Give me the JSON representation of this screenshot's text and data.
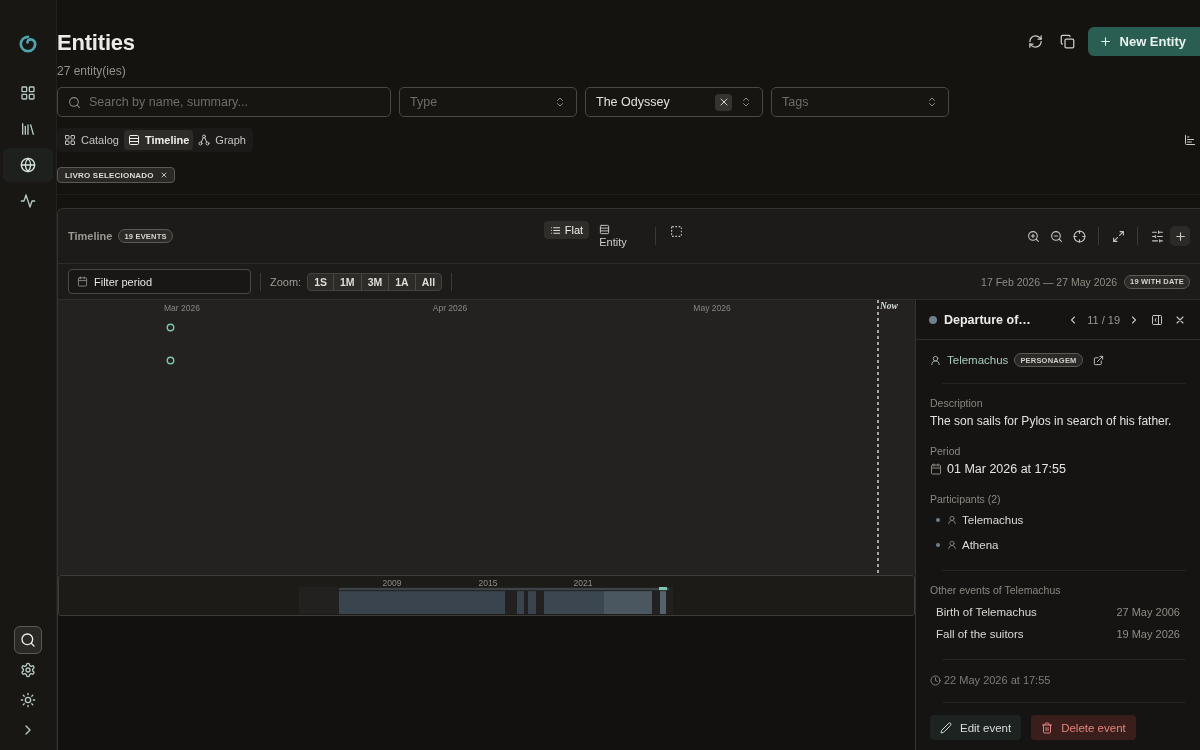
{
  "sidebar": {
    "nav": [
      {
        "kind": "grid",
        "selected": false
      },
      {
        "kind": "library",
        "selected": false
      },
      {
        "kind": "globe",
        "selected": true
      },
      {
        "kind": "pulse",
        "selected": false
      }
    ],
    "tools": [
      {
        "kind": "search",
        "selected": true
      },
      {
        "kind": "gear",
        "selected": false
      },
      {
        "kind": "sun",
        "selected": false
      },
      {
        "kind": "chevron",
        "selected": false
      }
    ]
  },
  "header": {
    "title": "Entities",
    "subtitle": "27 entity(ies)",
    "primary_button": "New Entity"
  },
  "filters": {
    "search": {
      "placeholder": "Search by name, summary..."
    },
    "type": {
      "placeholder": "Type"
    },
    "book": {
      "value": "The Odyssey"
    },
    "tags": {
      "placeholder": "Tags"
    }
  },
  "view_tabs": [
    {
      "label": "Catalog",
      "kind": "grid",
      "selected": false
    },
    {
      "label": "Timeline",
      "kind": "rows",
      "selected": true
    },
    {
      "label": "Graph",
      "kind": "network",
      "selected": false
    }
  ],
  "active_filters": [
    "LIVRO SELECIONADO"
  ],
  "timeline": {
    "title": "Timeline",
    "count": "19 EVENTS",
    "modes": [
      {
        "label": "Flat",
        "kind": "list",
        "selected": true
      },
      {
        "label": "Entity",
        "kind": "rows",
        "selected": false
      }
    ],
    "period_filter": {
      "placeholder": "Filter period"
    },
    "zoom_label": "Zoom:",
    "zoom_options": [
      {
        "label": "1S",
        "selected": false
      },
      {
        "label": "1M",
        "selected": false
      },
      {
        "label": "3M",
        "selected": false
      },
      {
        "label": "1A",
        "selected": false
      },
      {
        "label": "All",
        "selected": false
      }
    ],
    "range": "17 Feb 2026 — 27 May 2026",
    "dated_count": "19 WITH DATE",
    "axis_labels": [
      "Mar 2026",
      "Apr 2026",
      "May 2026"
    ],
    "now_label": "Now",
    "overview_labels": [
      "2009",
      "2015",
      "2021"
    ]
  },
  "details": {
    "title": "Departure of…",
    "position": "11 / 19",
    "entity": {
      "name": "Telemachus",
      "type": "PERSONAGEM"
    },
    "description_label": "Description",
    "description": "The son sails for Pylos in search of his father.",
    "period_label": "Period",
    "period": "01 Mar 2026 at 17:55",
    "participants_label": "Participants (2)",
    "participants": [
      "Telemachus",
      "Athena"
    ],
    "other_events_label": "Other events of Telemachus",
    "other_events": [
      {
        "name": "Birth of Telemachus",
        "date": "27 May 2006"
      },
      {
        "name": "Fall of the suitors",
        "date": "19 May 2026"
      }
    ],
    "updated": "22 May 2026 at 17:55",
    "edit_button": "Edit event",
    "delete_button": "Delete event"
  }
}
